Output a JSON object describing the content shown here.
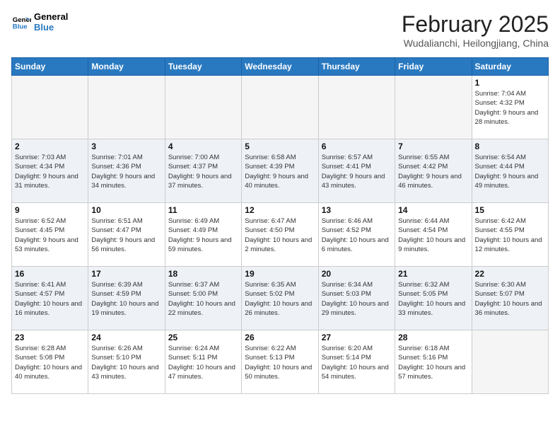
{
  "logo": {
    "line1": "General",
    "line2": "Blue"
  },
  "title": "February 2025",
  "location": "Wudalianchi, Heilongjiang, China",
  "days_of_week": [
    "Sunday",
    "Monday",
    "Tuesday",
    "Wednesday",
    "Thursday",
    "Friday",
    "Saturday"
  ],
  "weeks": [
    [
      {
        "day": "",
        "info": ""
      },
      {
        "day": "",
        "info": ""
      },
      {
        "day": "",
        "info": ""
      },
      {
        "day": "",
        "info": ""
      },
      {
        "day": "",
        "info": ""
      },
      {
        "day": "",
        "info": ""
      },
      {
        "day": "1",
        "info": "Sunrise: 7:04 AM\nSunset: 4:32 PM\nDaylight: 9 hours and 28 minutes."
      }
    ],
    [
      {
        "day": "2",
        "info": "Sunrise: 7:03 AM\nSunset: 4:34 PM\nDaylight: 9 hours and 31 minutes."
      },
      {
        "day": "3",
        "info": "Sunrise: 7:01 AM\nSunset: 4:36 PM\nDaylight: 9 hours and 34 minutes."
      },
      {
        "day": "4",
        "info": "Sunrise: 7:00 AM\nSunset: 4:37 PM\nDaylight: 9 hours and 37 minutes."
      },
      {
        "day": "5",
        "info": "Sunrise: 6:58 AM\nSunset: 4:39 PM\nDaylight: 9 hours and 40 minutes."
      },
      {
        "day": "6",
        "info": "Sunrise: 6:57 AM\nSunset: 4:41 PM\nDaylight: 9 hours and 43 minutes."
      },
      {
        "day": "7",
        "info": "Sunrise: 6:55 AM\nSunset: 4:42 PM\nDaylight: 9 hours and 46 minutes."
      },
      {
        "day": "8",
        "info": "Sunrise: 6:54 AM\nSunset: 4:44 PM\nDaylight: 9 hours and 49 minutes."
      }
    ],
    [
      {
        "day": "9",
        "info": "Sunrise: 6:52 AM\nSunset: 4:45 PM\nDaylight: 9 hours and 53 minutes."
      },
      {
        "day": "10",
        "info": "Sunrise: 6:51 AM\nSunset: 4:47 PM\nDaylight: 9 hours and 56 minutes."
      },
      {
        "day": "11",
        "info": "Sunrise: 6:49 AM\nSunset: 4:49 PM\nDaylight: 9 hours and 59 minutes."
      },
      {
        "day": "12",
        "info": "Sunrise: 6:47 AM\nSunset: 4:50 PM\nDaylight: 10 hours and 2 minutes."
      },
      {
        "day": "13",
        "info": "Sunrise: 6:46 AM\nSunset: 4:52 PM\nDaylight: 10 hours and 6 minutes."
      },
      {
        "day": "14",
        "info": "Sunrise: 6:44 AM\nSunset: 4:54 PM\nDaylight: 10 hours and 9 minutes."
      },
      {
        "day": "15",
        "info": "Sunrise: 6:42 AM\nSunset: 4:55 PM\nDaylight: 10 hours and 12 minutes."
      }
    ],
    [
      {
        "day": "16",
        "info": "Sunrise: 6:41 AM\nSunset: 4:57 PM\nDaylight: 10 hours and 16 minutes."
      },
      {
        "day": "17",
        "info": "Sunrise: 6:39 AM\nSunset: 4:59 PM\nDaylight: 10 hours and 19 minutes."
      },
      {
        "day": "18",
        "info": "Sunrise: 6:37 AM\nSunset: 5:00 PM\nDaylight: 10 hours and 22 minutes."
      },
      {
        "day": "19",
        "info": "Sunrise: 6:35 AM\nSunset: 5:02 PM\nDaylight: 10 hours and 26 minutes."
      },
      {
        "day": "20",
        "info": "Sunrise: 6:34 AM\nSunset: 5:03 PM\nDaylight: 10 hours and 29 minutes."
      },
      {
        "day": "21",
        "info": "Sunrise: 6:32 AM\nSunset: 5:05 PM\nDaylight: 10 hours and 33 minutes."
      },
      {
        "day": "22",
        "info": "Sunrise: 6:30 AM\nSunset: 5:07 PM\nDaylight: 10 hours and 36 minutes."
      }
    ],
    [
      {
        "day": "23",
        "info": "Sunrise: 6:28 AM\nSunset: 5:08 PM\nDaylight: 10 hours and 40 minutes."
      },
      {
        "day": "24",
        "info": "Sunrise: 6:26 AM\nSunset: 5:10 PM\nDaylight: 10 hours and 43 minutes."
      },
      {
        "day": "25",
        "info": "Sunrise: 6:24 AM\nSunset: 5:11 PM\nDaylight: 10 hours and 47 minutes."
      },
      {
        "day": "26",
        "info": "Sunrise: 6:22 AM\nSunset: 5:13 PM\nDaylight: 10 hours and 50 minutes."
      },
      {
        "day": "27",
        "info": "Sunrise: 6:20 AM\nSunset: 5:14 PM\nDaylight: 10 hours and 54 minutes."
      },
      {
        "day": "28",
        "info": "Sunrise: 6:18 AM\nSunset: 5:16 PM\nDaylight: 10 hours and 57 minutes."
      },
      {
        "day": "",
        "info": ""
      }
    ]
  ]
}
